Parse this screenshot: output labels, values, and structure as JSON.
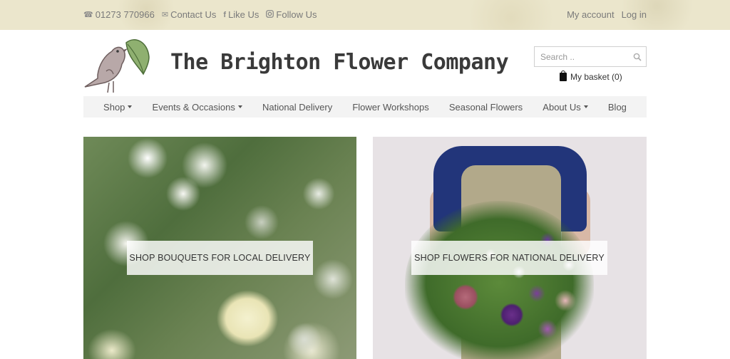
{
  "topbar": {
    "phone": "01273 770966",
    "contact": "Contact Us",
    "like": "Like Us",
    "follow": "Follow Us",
    "my_account": "My account",
    "log_in": "Log in"
  },
  "header": {
    "title": "The Brighton Flower Company",
    "search_placeholder": "Search ..",
    "basket_label": "My basket (0)"
  },
  "nav": {
    "items": [
      {
        "label": "Shop",
        "dropdown": true
      },
      {
        "label": "Events & Occasions",
        "dropdown": true
      },
      {
        "label": "National Delivery",
        "dropdown": false
      },
      {
        "label": "Flower Workshops",
        "dropdown": false
      },
      {
        "label": "Seasonal Flowers",
        "dropdown": false
      },
      {
        "label": "About Us",
        "dropdown": true
      },
      {
        "label": "Blog",
        "dropdown": false
      }
    ]
  },
  "panels": {
    "local": {
      "label": "SHOP BOUQUETS FOR LOCAL DELIVERY"
    },
    "national": {
      "label": "SHOP FLOWERS FOR NATIONAL DELIVERY"
    }
  },
  "colors": {
    "topbar_bg": "#ebe6cc",
    "nav_bg": "#f3f3f3",
    "text": "#333333"
  }
}
